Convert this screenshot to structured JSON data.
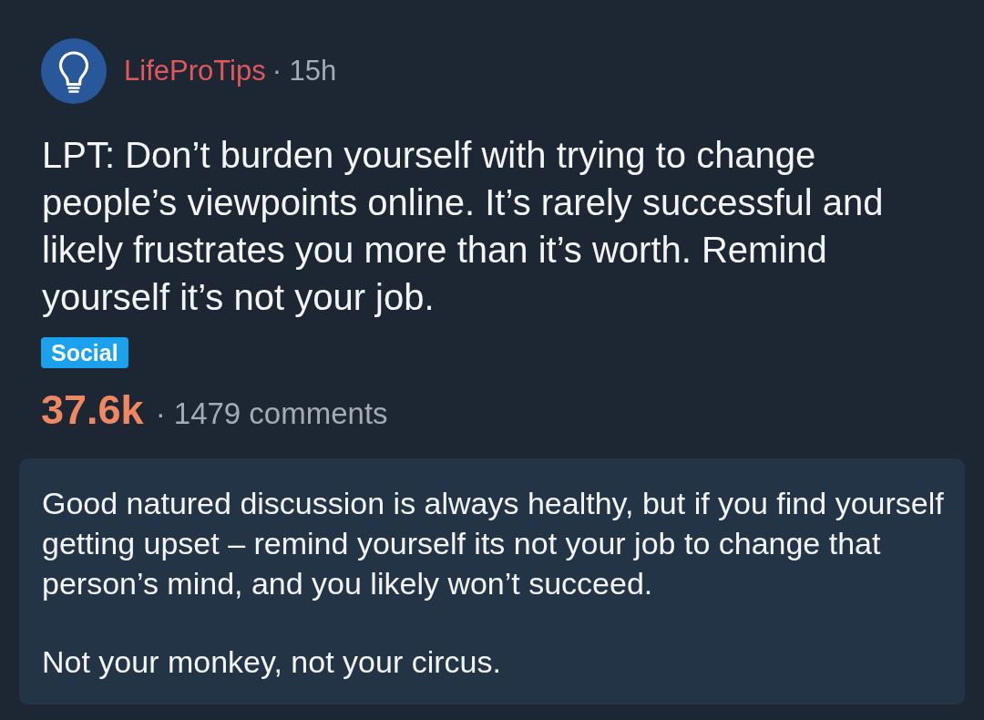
{
  "post": {
    "subreddit": "LifeProTips",
    "time": "· 15h",
    "title": "LPT: Don’t burden yourself with trying to change people’s viewpoints online. It’s rarely successful and likely frustrates you more than it’s worth. Remind yourself it’s not your job.",
    "flair": "Social",
    "score": "37.6k",
    "comments": "· 1479 comments"
  },
  "body": {
    "paragraphs": [
      "Good natured discussion is always healthy, but if you find yourself getting upset – remind yourself its not your job to change that person’s mind, and you likely won’t succeed.",
      "Not your monkey, not your circus."
    ]
  }
}
